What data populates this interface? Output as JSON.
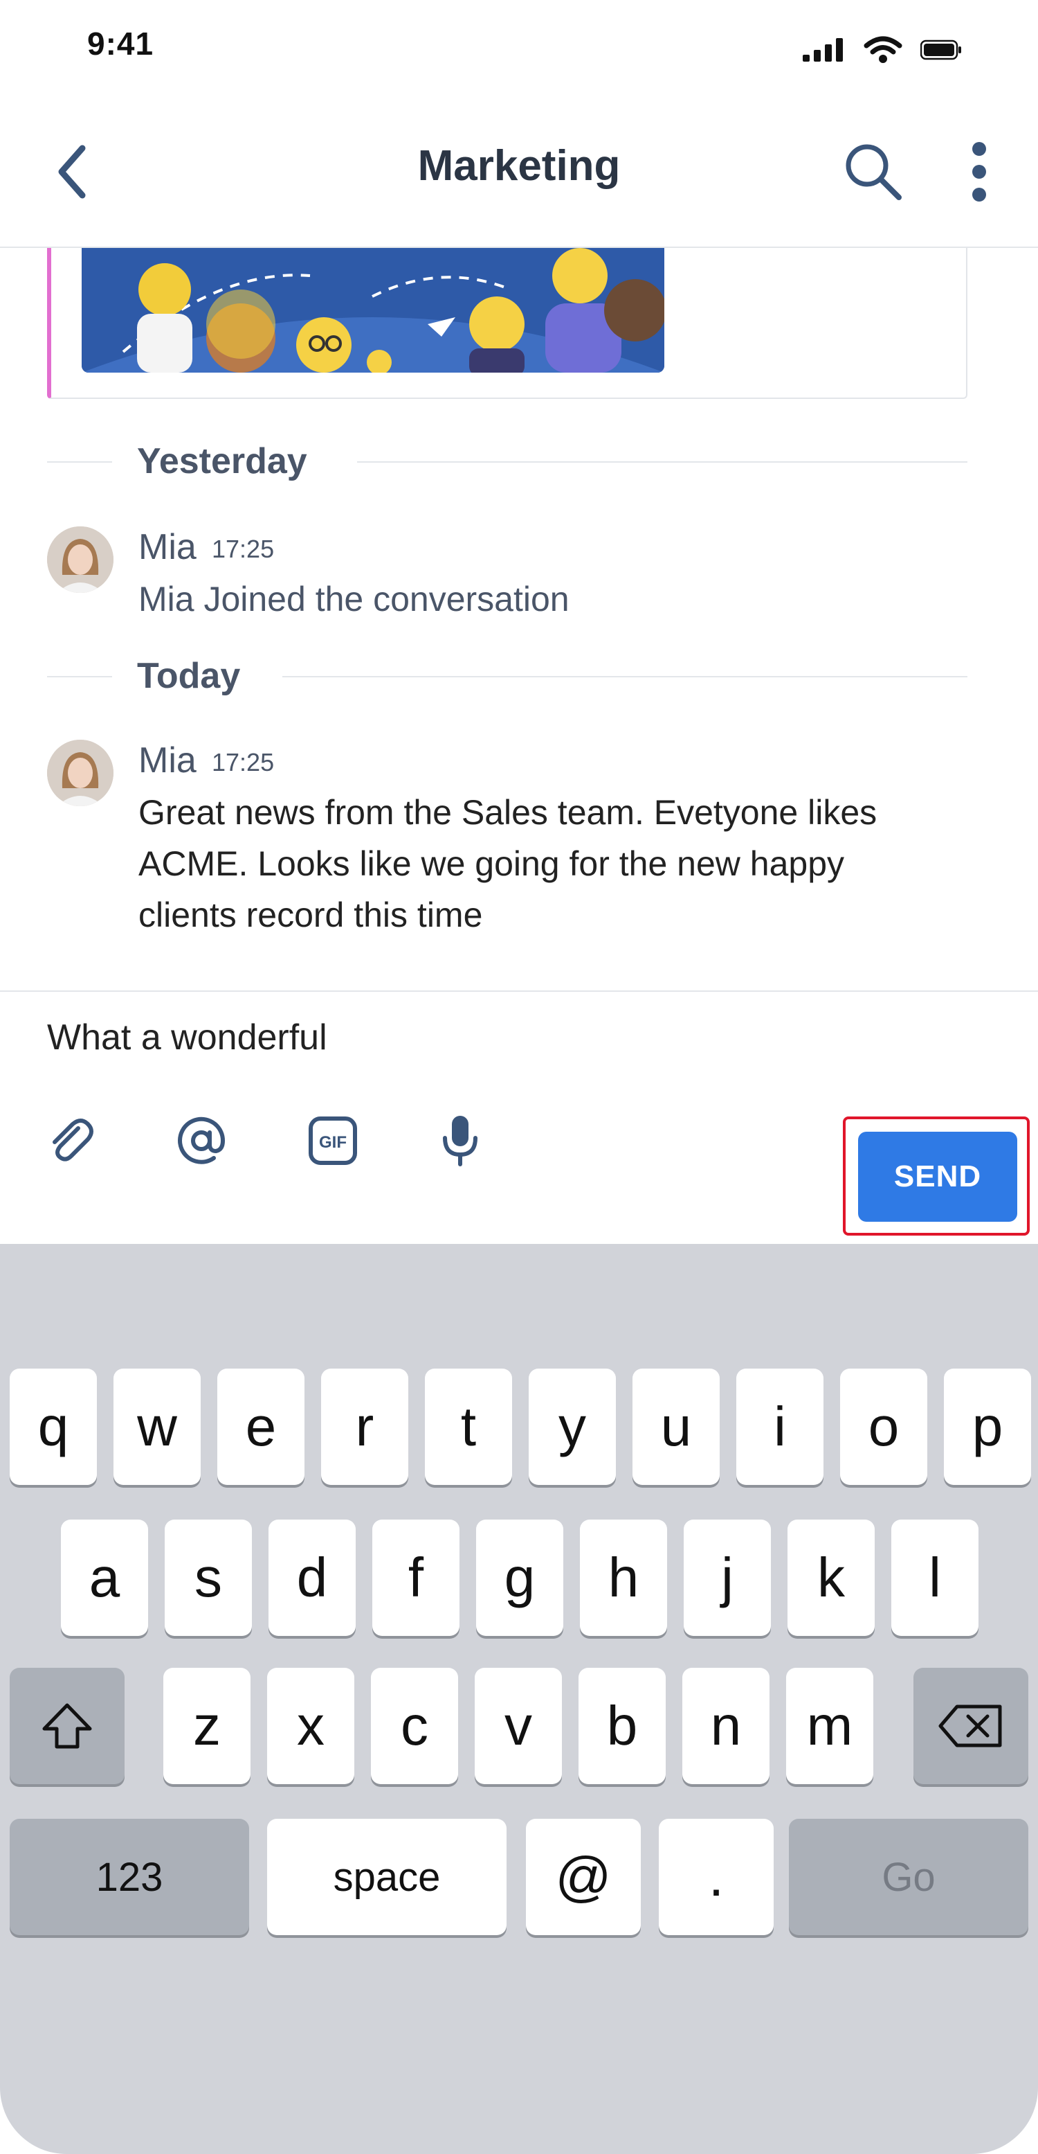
{
  "status_bar": {
    "time": "9:41",
    "icons": [
      "signal-icon",
      "wifi-icon",
      "battery-icon"
    ]
  },
  "header": {
    "title": "Marketing",
    "back_icon": "chevron-left-icon",
    "search_icon": "search-icon",
    "more_icon": "more-vertical-icon"
  },
  "conversation": {
    "dividers": [
      {
        "label": "Yesterday"
      },
      {
        "label": "Today"
      }
    ],
    "messages": [
      {
        "author": "Mia",
        "time": "17:25",
        "text": "Mia Joined the conversation",
        "kind": "system"
      },
      {
        "author": "Mia",
        "time": "17:25",
        "text": "Great news from the Sales team. Evetyone likes ACME. Looks like we going for the new happy clients record this time",
        "kind": "message"
      }
    ]
  },
  "composer": {
    "value": "What a wonderful",
    "tools": [
      "paperclip-icon",
      "at-sign-icon",
      "gif-icon",
      "microphone-icon"
    ],
    "send_label": "SEND"
  },
  "keyboard": {
    "row1": [
      "q",
      "w",
      "e",
      "r",
      "t",
      "y",
      "u",
      "i",
      "o",
      "p"
    ],
    "row2": [
      "a",
      "s",
      "d",
      "f",
      "g",
      "h",
      "j",
      "k",
      "l"
    ],
    "row3": [
      "z",
      "x",
      "c",
      "v",
      "b",
      "n",
      "m"
    ],
    "row4": {
      "numbers": "123",
      "space": "space",
      "at": "@",
      "dot": ".",
      "go": "Go"
    },
    "shift_icon": "shift-icon",
    "backspace_icon": "backspace-icon"
  },
  "colors": {
    "accent": "#2f7ae5",
    "highlight": "#e0162b",
    "attachment_bar": "#e26fd0",
    "keyboard_bg": "#d1d3d9"
  }
}
